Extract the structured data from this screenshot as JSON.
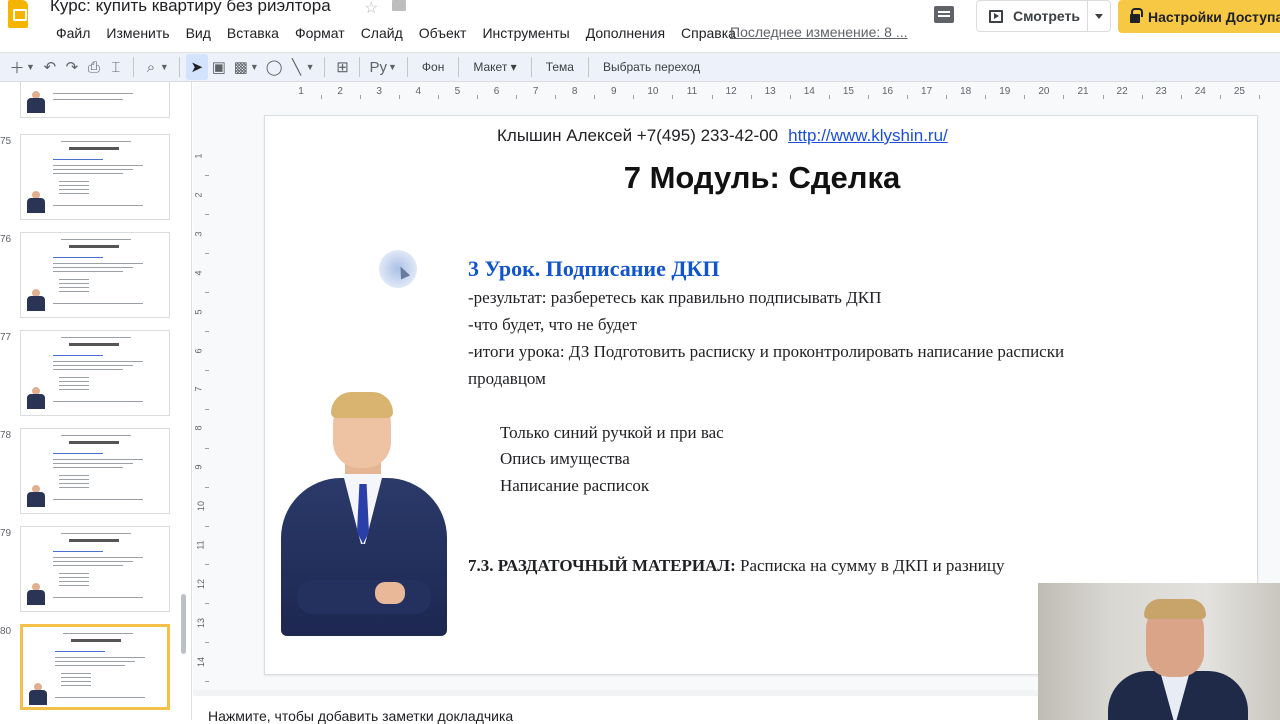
{
  "window": {
    "doc_title": "Курс: купить квартиру без риэлтора",
    "last_edit": "Последнее изменение: 8 ..."
  },
  "menu": [
    "Файл",
    "Изменить",
    "Вид",
    "Вставка",
    "Формат",
    "Слайд",
    "Объект",
    "Инструменты",
    "Дополнения",
    "Справка"
  ],
  "header_buttons": {
    "present": "Смотреть",
    "share": "Настройки Доступа"
  },
  "toolbar": {
    "background": "Фон",
    "layout": "Макет",
    "theme": "Тема",
    "transition": "Выбрать переход"
  },
  "filmstrip": {
    "slides": [
      {
        "number": "75"
      },
      {
        "number": "76"
      },
      {
        "number": "77"
      },
      {
        "number": "78"
      },
      {
        "number": "79"
      },
      {
        "number": "80"
      }
    ]
  },
  "ruler": {
    "h": [
      "1",
      "2",
      "3",
      "4",
      "5",
      "6",
      "7",
      "8",
      "9",
      "10",
      "11",
      "12",
      "13",
      "14",
      "15",
      "16",
      "17",
      "18",
      "19",
      "20",
      "21",
      "22",
      "23",
      "24",
      "25"
    ],
    "v": [
      "1",
      "2",
      "3",
      "4",
      "5",
      "6",
      "7",
      "8",
      "9",
      "10",
      "11",
      "12",
      "13",
      "14"
    ]
  },
  "slide": {
    "author": "Клышин Алексей  +7(495) 233-42-00",
    "link": "http://www.klyshin.ru/",
    "title": "7 Модуль: Сделка",
    "lesson_title": "3 Урок. Подписание ДКП",
    "lines": [
      "-результат: разберетесь как правильно подписывать ДКП",
      "-что будет, что не будет",
      "-итоги урока: ДЗ  Подготовить  расписку и проконтролировать написание расписки",
      "продавцом"
    ],
    "sub_lines": [
      "Только синий ручкой и при вас",
      "Опись имущества",
      "Написание расписок"
    ],
    "handout_label": "7.3. РАЗДАТОЧНЫЙ МАТЕРИАЛ:",
    "handout_text": " Расписка на сумму в ДКП и разницу"
  },
  "notes": {
    "placeholder": "Нажмите, чтобы добавить заметки докладчика"
  },
  "colors": {
    "accent_share": "#f7c843",
    "lesson_title": "#1155cc",
    "link": "#1a4fd6",
    "selection": "#f4c04a"
  }
}
